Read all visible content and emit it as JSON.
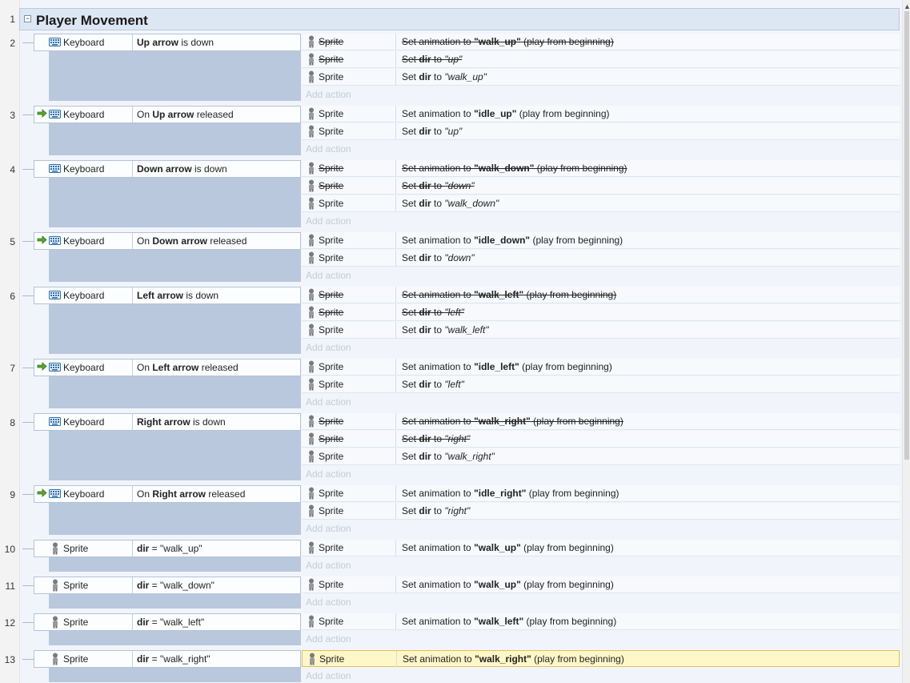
{
  "group": {
    "title": "Player Movement",
    "collapse_symbol": "−",
    "line": "1"
  },
  "add_action_label": "Add action",
  "events": [
    {
      "line": "2",
      "trigger": false,
      "object": "Keyboard",
      "object_icon": "keyboard-icon",
      "condition": {
        "bold": "Up arrow",
        "after": " is down"
      },
      "actions": [
        {
          "object": "Sprite",
          "disabled": true,
          "parts": [
            [
              "Set animation to ",
              ""
            ],
            [
              "\"walk_up\"",
              "b"
            ],
            [
              " (play from beginning)",
              ""
            ]
          ]
        },
        {
          "object": "Sprite",
          "disabled": true,
          "parts": [
            [
              "Set ",
              ""
            ],
            [
              "dir",
              "b"
            ],
            [
              " to ",
              ""
            ],
            [
              "\"up\"",
              "i"
            ]
          ]
        },
        {
          "object": "Sprite",
          "disabled": false,
          "parts": [
            [
              "Set ",
              ""
            ],
            [
              "dir",
              "b"
            ],
            [
              " to ",
              ""
            ],
            [
              "\"walk_up\"",
              "i"
            ]
          ]
        }
      ]
    },
    {
      "line": "3",
      "trigger": true,
      "object": "Keyboard",
      "object_icon": "keyboard-icon",
      "condition": {
        "before": "On ",
        "bold": "Up arrow",
        "after": " released"
      },
      "actions": [
        {
          "object": "Sprite",
          "disabled": false,
          "parts": [
            [
              "Set animation to ",
              ""
            ],
            [
              "\"idle_up\"",
              "b"
            ],
            [
              " (play from beginning)",
              ""
            ]
          ]
        },
        {
          "object": "Sprite",
          "disabled": false,
          "parts": [
            [
              "Set ",
              ""
            ],
            [
              "dir",
              "b"
            ],
            [
              " to ",
              ""
            ],
            [
              "\"up\"",
              "i"
            ]
          ]
        }
      ]
    },
    {
      "line": "4",
      "trigger": false,
      "object": "Keyboard",
      "object_icon": "keyboard-icon",
      "condition": {
        "bold": "Down arrow",
        "after": " is down"
      },
      "actions": [
        {
          "object": "Sprite",
          "disabled": true,
          "parts": [
            [
              "Set animation to ",
              ""
            ],
            [
              "\"walk_down\"",
              "b"
            ],
            [
              " (play from beginning)",
              ""
            ]
          ]
        },
        {
          "object": "Sprite",
          "disabled": true,
          "parts": [
            [
              "Set ",
              ""
            ],
            [
              "dir",
              "b"
            ],
            [
              " to ",
              ""
            ],
            [
              "\"down\"",
              "i"
            ]
          ]
        },
        {
          "object": "Sprite",
          "disabled": false,
          "parts": [
            [
              "Set ",
              ""
            ],
            [
              "dir",
              "b"
            ],
            [
              " to ",
              ""
            ],
            [
              "\"walk_down\"",
              "i"
            ]
          ]
        }
      ]
    },
    {
      "line": "5",
      "trigger": true,
      "object": "Keyboard",
      "object_icon": "keyboard-icon",
      "condition": {
        "before": "On ",
        "bold": "Down arrow",
        "after": " released"
      },
      "actions": [
        {
          "object": "Sprite",
          "disabled": false,
          "parts": [
            [
              "Set animation to ",
              ""
            ],
            [
              "\"idle_down\"",
              "b"
            ],
            [
              " (play from beginning)",
              ""
            ]
          ]
        },
        {
          "object": "Sprite",
          "disabled": false,
          "parts": [
            [
              "Set ",
              ""
            ],
            [
              "dir",
              "b"
            ],
            [
              " to ",
              ""
            ],
            [
              "\"down\"",
              "i"
            ]
          ]
        }
      ]
    },
    {
      "line": "6",
      "trigger": false,
      "object": "Keyboard",
      "object_icon": "keyboard-icon",
      "condition": {
        "bold": "Left arrow",
        "after": " is down"
      },
      "actions": [
        {
          "object": "Sprite",
          "disabled": true,
          "parts": [
            [
              "Set animation to ",
              ""
            ],
            [
              "\"walk_left\"",
              "b"
            ],
            [
              " (play from beginning)",
              ""
            ]
          ]
        },
        {
          "object": "Sprite",
          "disabled": true,
          "parts": [
            [
              "Set ",
              ""
            ],
            [
              "dir",
              "b"
            ],
            [
              " to ",
              ""
            ],
            [
              "\"left\"",
              "i"
            ]
          ]
        },
        {
          "object": "Sprite",
          "disabled": false,
          "parts": [
            [
              "Set ",
              ""
            ],
            [
              "dir",
              "b"
            ],
            [
              " to ",
              ""
            ],
            [
              "\"walk_left\"",
              "i"
            ]
          ]
        }
      ]
    },
    {
      "line": "7",
      "trigger": true,
      "object": "Keyboard",
      "object_icon": "keyboard-icon",
      "condition": {
        "before": "On ",
        "bold": "Left arrow",
        "after": " released"
      },
      "actions": [
        {
          "object": "Sprite",
          "disabled": false,
          "parts": [
            [
              "Set animation to ",
              ""
            ],
            [
              "\"idle_left\"",
              "b"
            ],
            [
              " (play from beginning)",
              ""
            ]
          ]
        },
        {
          "object": "Sprite",
          "disabled": false,
          "parts": [
            [
              "Set ",
              ""
            ],
            [
              "dir",
              "b"
            ],
            [
              " to ",
              ""
            ],
            [
              "\"left\"",
              "i"
            ]
          ]
        }
      ]
    },
    {
      "line": "8",
      "trigger": false,
      "object": "Keyboard",
      "object_icon": "keyboard-icon",
      "condition": {
        "bold": "Right arrow",
        "after": " is down"
      },
      "actions": [
        {
          "object": "Sprite",
          "disabled": true,
          "parts": [
            [
              "Set animation to ",
              ""
            ],
            [
              "\"walk_right\"",
              "b"
            ],
            [
              " (play from beginning)",
              ""
            ]
          ]
        },
        {
          "object": "Sprite",
          "disabled": true,
          "parts": [
            [
              "Set ",
              ""
            ],
            [
              "dir",
              "b"
            ],
            [
              " to ",
              ""
            ],
            [
              "\"right\"",
              "i"
            ]
          ]
        },
        {
          "object": "Sprite",
          "disabled": false,
          "parts": [
            [
              "Set ",
              ""
            ],
            [
              "dir",
              "b"
            ],
            [
              " to ",
              ""
            ],
            [
              "\"walk_right\"",
              "i"
            ]
          ]
        }
      ]
    },
    {
      "line": "9",
      "trigger": true,
      "object": "Keyboard",
      "object_icon": "keyboard-icon",
      "condition": {
        "before": "On ",
        "bold": "Right arrow",
        "after": " released"
      },
      "actions": [
        {
          "object": "Sprite",
          "disabled": false,
          "parts": [
            [
              "Set animation to ",
              ""
            ],
            [
              "\"idle_right\"",
              "b"
            ],
            [
              " (play from beginning)",
              ""
            ]
          ]
        },
        {
          "object": "Sprite",
          "disabled": false,
          "parts": [
            [
              "Set ",
              ""
            ],
            [
              "dir",
              "b"
            ],
            [
              " to ",
              ""
            ],
            [
              "\"right\"",
              "i"
            ]
          ]
        }
      ]
    },
    {
      "line": "10",
      "trigger": false,
      "object": "Sprite",
      "object_icon": "sprite-icon",
      "condition": {
        "bold": "dir",
        "after": " = \"walk_up\""
      },
      "actions": [
        {
          "object": "Sprite",
          "disabled": false,
          "parts": [
            [
              "Set animation to ",
              ""
            ],
            [
              "\"walk_up\"",
              "b"
            ],
            [
              " (play from beginning)",
              ""
            ]
          ]
        }
      ]
    },
    {
      "line": "11",
      "trigger": false,
      "object": "Sprite",
      "object_icon": "sprite-icon",
      "condition": {
        "bold": "dir",
        "after": " = \"walk_down\""
      },
      "actions": [
        {
          "object": "Sprite",
          "disabled": false,
          "parts": [
            [
              "Set animation to ",
              ""
            ],
            [
              "\"walk_up\"",
              "b"
            ],
            [
              " (play from beginning)",
              ""
            ]
          ]
        }
      ]
    },
    {
      "line": "12",
      "trigger": false,
      "object": "Sprite",
      "object_icon": "sprite-icon",
      "condition": {
        "bold": "dir",
        "after": " = \"walk_left\""
      },
      "actions": [
        {
          "object": "Sprite",
          "disabled": false,
          "parts": [
            [
              "Set animation to ",
              ""
            ],
            [
              "\"walk_left\"",
              "b"
            ],
            [
              " (play from beginning)",
              ""
            ]
          ]
        }
      ]
    },
    {
      "line": "13",
      "trigger": false,
      "object": "Sprite",
      "object_icon": "sprite-icon",
      "condition": {
        "bold": "dir",
        "after": " = \"walk_right\""
      },
      "actions": [
        {
          "object": "Sprite",
          "disabled": false,
          "selected": true,
          "parts": [
            [
              "Set animation to ",
              ""
            ],
            [
              "\"walk_right\"",
              "b"
            ],
            [
              " (play from beginning)",
              ""
            ]
          ]
        }
      ]
    }
  ]
}
